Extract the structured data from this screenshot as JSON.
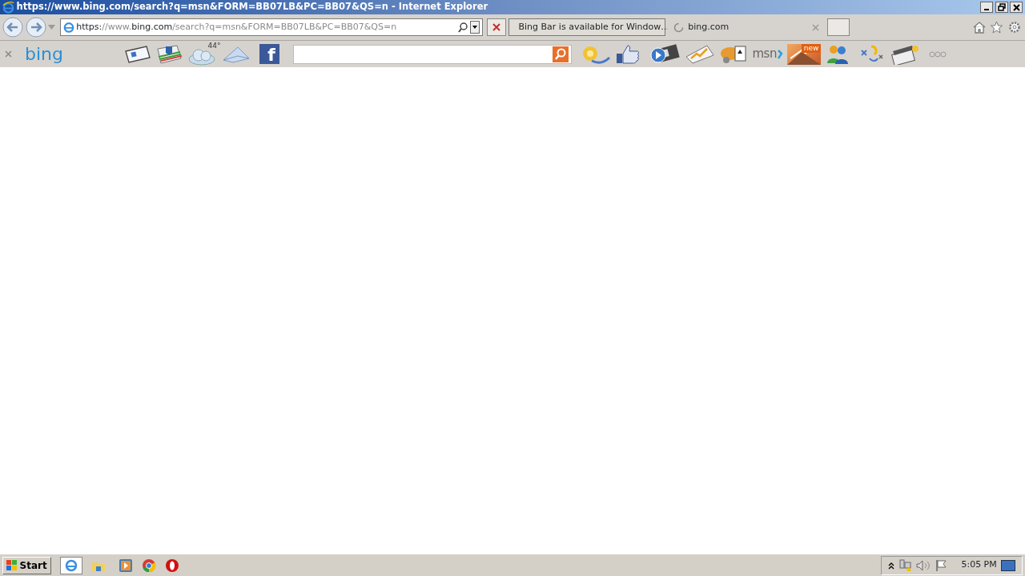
{
  "window": {
    "title": "https://www.bing.com/search?q=msn&FORM=BB07LB&PC=BB07&QS=n - Internet Explorer"
  },
  "address_bar": {
    "url_parts": [
      {
        "text": "https:",
        "dim": false
      },
      {
        "text": "//www.",
        "dim": true
      },
      {
        "text": "bing.com",
        "dim": false
      },
      {
        "text": "/search?q=msn&FORM=BB07LB&PC=BB07&QS=n",
        "dim": true
      }
    ]
  },
  "tabs": [
    {
      "label": "Bing Bar is available for Window…",
      "selected": false,
      "kind": "page"
    },
    {
      "label": "bing.com",
      "selected": true,
      "kind": "loading"
    }
  ],
  "bing_bar": {
    "logo": "bing",
    "weather": "44°",
    "facebook": "f",
    "msn": "msn",
    "badge": "new"
  },
  "taskbar": {
    "start": "Start",
    "clock": "5:05 PM"
  }
}
